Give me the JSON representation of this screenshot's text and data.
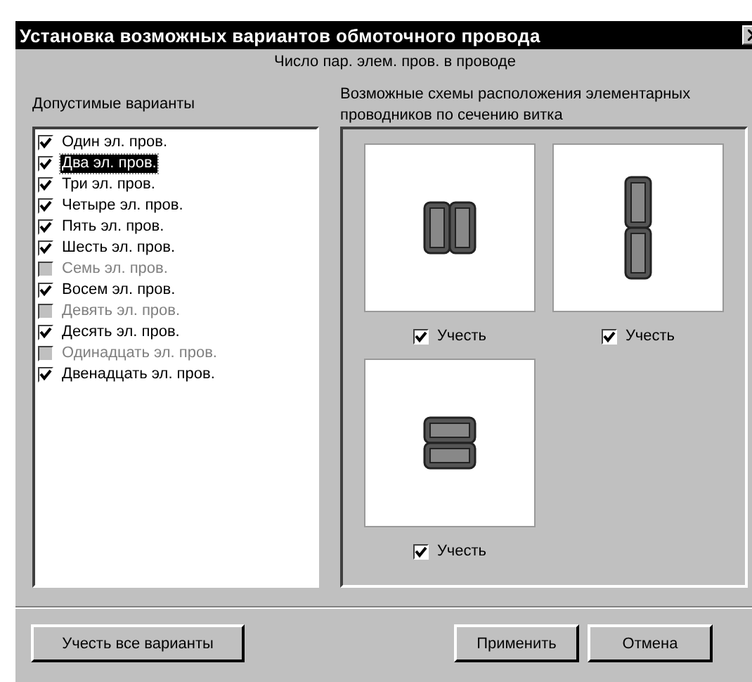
{
  "window": {
    "title": "Установка возможных вариантов обмоточного провода"
  },
  "subtitle": "Число пар. элем. пров. в проводе",
  "variants": {
    "label": "Допустимые варианты",
    "items": [
      {
        "label": "Один эл. пров.",
        "checked": true,
        "disabled": false,
        "selected": false
      },
      {
        "label": "Два эл. пров.",
        "checked": true,
        "disabled": false,
        "selected": true
      },
      {
        "label": "Три эл. пров.",
        "checked": true,
        "disabled": false,
        "selected": false
      },
      {
        "label": "Четыре эл. пров.",
        "checked": true,
        "disabled": false,
        "selected": false
      },
      {
        "label": "Пять эл. пров.",
        "checked": true,
        "disabled": false,
        "selected": false
      },
      {
        "label": "Шесть эл. пров.",
        "checked": true,
        "disabled": false,
        "selected": false
      },
      {
        "label": "Семь эл. пров.",
        "checked": false,
        "disabled": true,
        "selected": false
      },
      {
        "label": "Восем эл. пров.",
        "checked": true,
        "disabled": false,
        "selected": false
      },
      {
        "label": "Девять эл. пров.",
        "checked": false,
        "disabled": true,
        "selected": false
      },
      {
        "label": "Десять эл. пров.",
        "checked": true,
        "disabled": false,
        "selected": false
      },
      {
        "label": "Одинадцать эл. пров.",
        "checked": false,
        "disabled": true,
        "selected": false
      },
      {
        "label": "Двенадцать эл. пров.",
        "checked": true,
        "disabled": false,
        "selected": false
      }
    ]
  },
  "schemes": {
    "label": "Возможные схемы расположения элементарных проводников по сечению витка",
    "items": [
      {
        "kind": "side",
        "label": "Учесть",
        "checked": true
      },
      {
        "kind": "vertical",
        "label": "Учесть",
        "checked": true
      },
      {
        "kind": "horizontal",
        "label": "Учесть",
        "checked": true
      }
    ]
  },
  "buttons": [
    {
      "label": "Учесть все варианты"
    },
    {
      "label": "Применить"
    },
    {
      "label": "Отмена"
    }
  ]
}
